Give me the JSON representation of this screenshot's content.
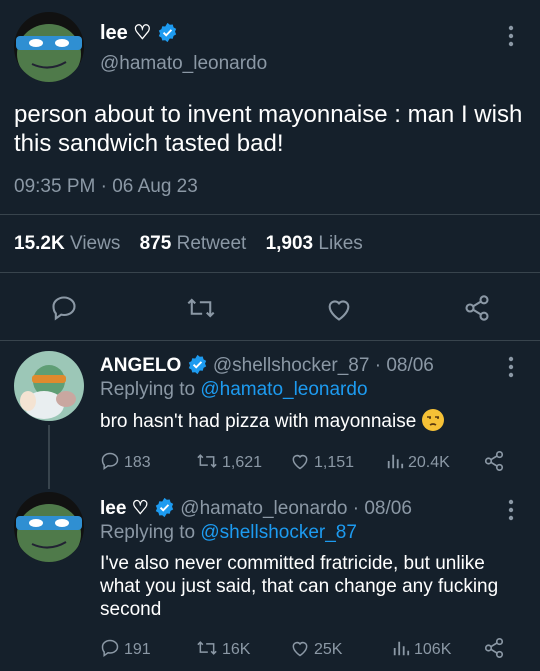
{
  "main_tweet": {
    "display_name": "lee ♡",
    "handle": "@hamato_leonardo",
    "text": "person about to invent mayonnaise : man I wish this sandwich tasted bad!",
    "timestamp": "09:35 PM · 06 Aug 23",
    "views_count": "15.2K",
    "views_label": "Views",
    "retweet_count": "875",
    "retweet_label": "Retweet",
    "likes_count": "1,903",
    "likes_label": "Likes"
  },
  "replies": [
    {
      "display_name": "ANGELO",
      "handle_date": "@shellshocker_87 · 08/06",
      "replying_prefix": "Replying to ",
      "replying_to": "@hamato_leonardo",
      "text": "bro hasn't had pizza with mayonnaise",
      "emoji": "unamused-face",
      "metrics": {
        "replies": "183",
        "retweets": "1,621",
        "likes": "1,151",
        "views": "20.4K"
      }
    },
    {
      "display_name": "lee ♡",
      "handle_date": "@hamato_leonardo · 08/06",
      "replying_prefix": "Replying to ",
      "replying_to": "@shellshocker_87",
      "text": "I've also never committed fratricide, but unlike what you just said, that can change any fucking second",
      "metrics": {
        "replies": "191",
        "retweets": "16K",
        "likes": "25K",
        "views": "106K"
      }
    }
  ],
  "colors": {
    "background": "#15202b",
    "accent": "#1d9bf0",
    "muted": "#8b98a5",
    "divider": "#38444d"
  },
  "icons": [
    "verified-badge-icon",
    "more-options-icon",
    "reply-icon",
    "retweet-icon",
    "like-icon",
    "share-icon",
    "views-icon"
  ]
}
